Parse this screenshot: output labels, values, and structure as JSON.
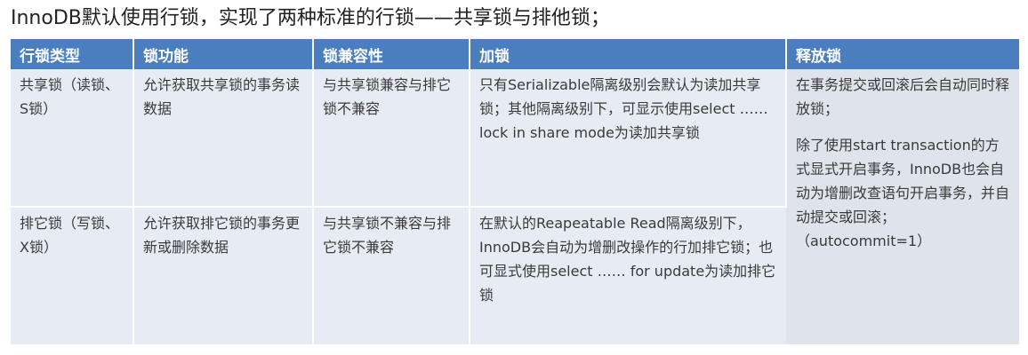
{
  "heading": "InnoDB默认使用行锁，实现了两种标准的行锁——共享锁与排他锁；",
  "table": {
    "headers": [
      "行锁类型",
      "锁功能",
      "锁兼容性",
      "加锁",
      "释放锁"
    ],
    "rows": [
      {
        "type": "共享锁（读锁、S锁）",
        "function": "允许获取共享锁的事务读数据",
        "compatibility": "与共享锁兼容与排它锁不兼容",
        "locking": "只有Serializable隔离级别会默认为读加共享锁；其他隔离级别下，可显示使用select …… lock in share mode为读加共享锁"
      },
      {
        "type": "排它锁（写锁、X锁）",
        "function": "允许获取排它锁的事务更新或删除数据",
        "compatibility": "与共享锁不兼容与排它锁不兼容",
        "locking": "在默认的Reapeatable Read隔离级别下，InnoDB会自动为增删改操作的行加排它锁；也可显式使用select …… for update为读加排它锁"
      }
    ],
    "release": {
      "para1": "在事务提交或回滚后会自动同时释放锁；",
      "para2": "除了使用start transaction的方式显式开启事务，InnoDB也会自动为增删改查语句开启事务，并自动提交或回滚；",
      "para3": "（autocommit=1）"
    }
  }
}
